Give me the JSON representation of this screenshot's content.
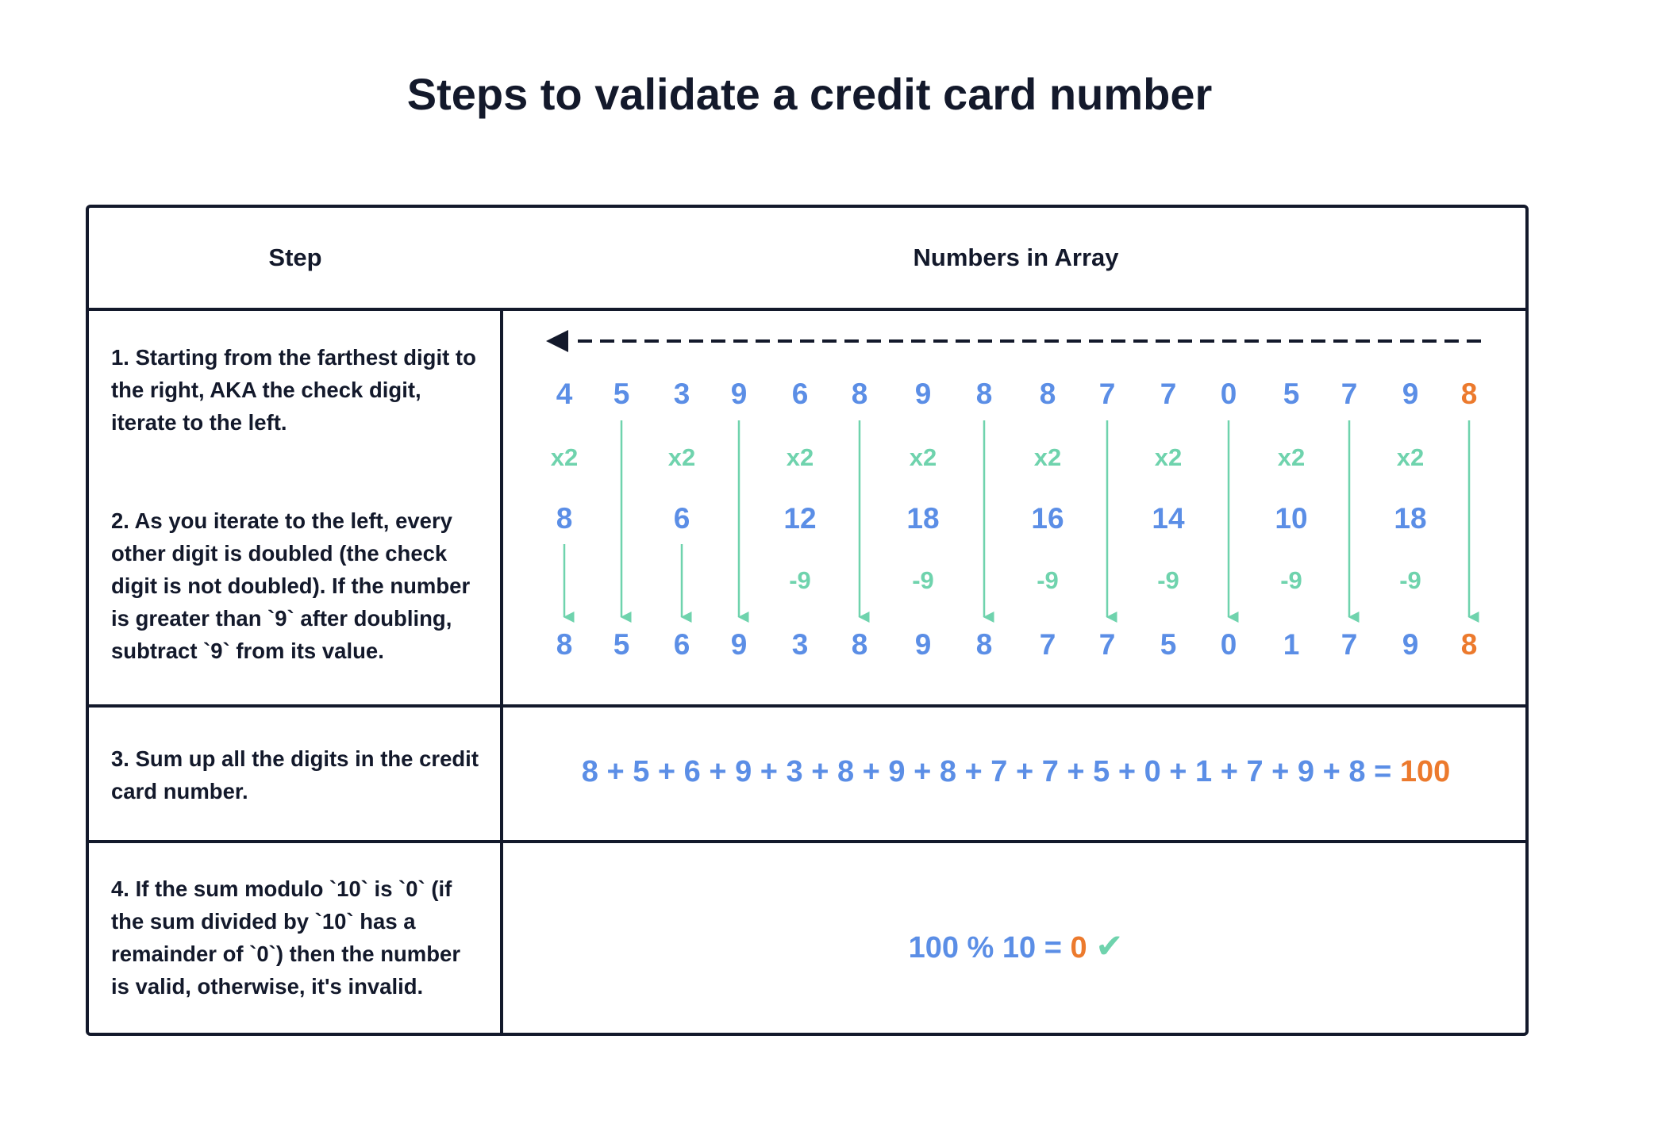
{
  "title": "Steps to validate a credit card number",
  "table": {
    "header_step": "Step",
    "header_numbers": "Numbers in Array",
    "step1": "1. Starting from the farthest digit to the right, AKA the check digit, iterate to the left.",
    "step2": "2. As you iterate to the left, every other digit is doubled (the check digit is not doubled). If the number is greater than `9` after doubling, subtract `9` from its value.",
    "step3": "3. Sum up all the digits in the credit card number.",
    "step4": "4. If the sum modulo `10` is `0` (if the sum divided by `10` has a remainder of `0`) then the number is valid, otherwise, it's invalid."
  },
  "digits": [
    {
      "original": "4",
      "op": "x2",
      "doubled": "8",
      "subtract": "",
      "result": "8"
    },
    {
      "original": "5",
      "op": "",
      "doubled": "",
      "subtract": "",
      "result": "5"
    },
    {
      "original": "3",
      "op": "x2",
      "doubled": "6",
      "subtract": "",
      "result": "6"
    },
    {
      "original": "9",
      "op": "",
      "doubled": "",
      "subtract": "",
      "result": "9"
    },
    {
      "original": "6",
      "op": "x2",
      "doubled": "12",
      "subtract": "-9",
      "result": "3"
    },
    {
      "original": "8",
      "op": "",
      "doubled": "",
      "subtract": "",
      "result": "8"
    },
    {
      "original": "9",
      "op": "x2",
      "doubled": "18",
      "subtract": "-9",
      "result": "9"
    },
    {
      "original": "8",
      "op": "",
      "doubled": "",
      "subtract": "",
      "result": "8"
    },
    {
      "original": "8",
      "op": "x2",
      "doubled": "16",
      "subtract": "-9",
      "result": "7"
    },
    {
      "original": "7",
      "op": "",
      "doubled": "",
      "subtract": "",
      "result": "7"
    },
    {
      "original": "7",
      "op": "x2",
      "doubled": "14",
      "subtract": "-9",
      "result": "5"
    },
    {
      "original": "0",
      "op": "",
      "doubled": "",
      "subtract": "",
      "result": "0"
    },
    {
      "original": "5",
      "op": "x2",
      "doubled": "10",
      "subtract": "-9",
      "result": "1"
    },
    {
      "original": "7",
      "op": "",
      "doubled": "",
      "subtract": "",
      "result": "7"
    },
    {
      "original": "9",
      "op": "x2",
      "doubled": "18",
      "subtract": "-9",
      "result": "9"
    },
    {
      "original": "8",
      "op": "",
      "doubled": "",
      "subtract": "",
      "result": "8"
    }
  ],
  "sum": {
    "expression": "8 + 5 + 6 + 9 + 3 + 8 + 9 + 8 + 7 + 7 + 5 + 0 + 1 + 7 + 9 + 8 =",
    "total": "100"
  },
  "modulo": {
    "expression": "100 % 10 =",
    "result": "0",
    "check": "✔"
  },
  "colors": {
    "text": "#13192b",
    "digit_blue": "#5b8ee6",
    "check_orange": "#ec7a2d",
    "op_green": "#6fd3ad",
    "border": "#13192b"
  }
}
